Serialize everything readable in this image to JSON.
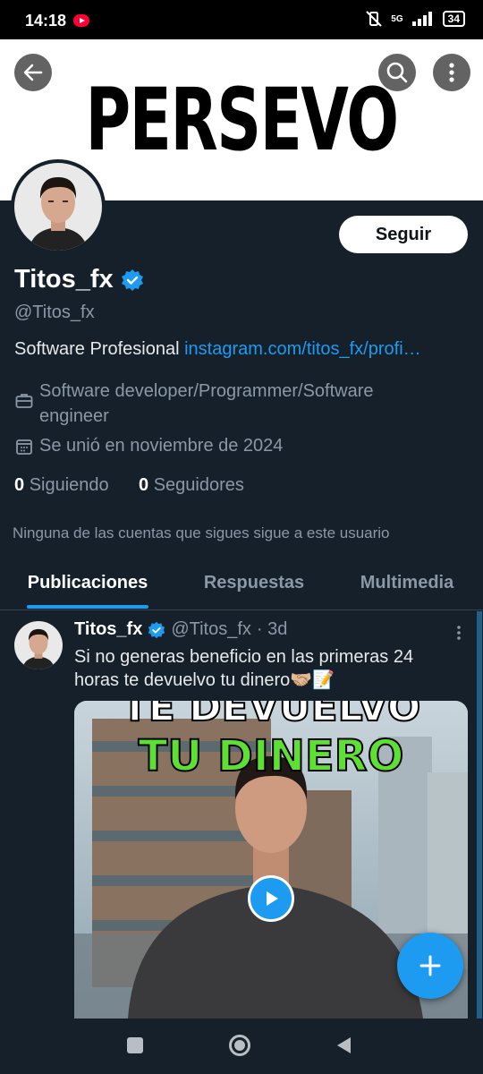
{
  "status_bar": {
    "time": "14:18",
    "network": "5G",
    "battery": "34"
  },
  "banner": {
    "text": "PERSEVO"
  },
  "profile": {
    "display_name": "Titos_fx",
    "handle": "@Titos_fx",
    "bio_text": "Software Profesional ",
    "bio_link": "instagram.com/titos_fx/profi…",
    "occupation_line1": "Software developer/Programmer/Software",
    "occupation_line2": "engineer",
    "joined": "Se unió en noviembre de 2024",
    "following_count": "0",
    "following_label": "Siguiendo",
    "followers_count": "0",
    "followers_label": "Seguidores",
    "mutuals_note": "Ninguna de las cuentas que sigues sigue a este usuario",
    "follow_button": "Seguir"
  },
  "tabs": [
    {
      "label": "Publicaciones",
      "active": true
    },
    {
      "label": "Respuestas",
      "active": false
    },
    {
      "label": "Multimedia",
      "active": false
    }
  ],
  "post": {
    "author": "Titos_fx",
    "handle": "@Titos_fx",
    "time": "· 3d",
    "text_line1": "Si no generas beneficio en las primeras 24",
    "text_line2": "horas te devuelvo tu dinero🤝🏼📝",
    "video_caption_top": "TE DEVUELVO",
    "video_caption": "TU DINERO"
  },
  "colors": {
    "background": "#15202b",
    "accent": "#1d9bf0",
    "muted": "#8b98a5",
    "caption_green": "#5de033"
  }
}
